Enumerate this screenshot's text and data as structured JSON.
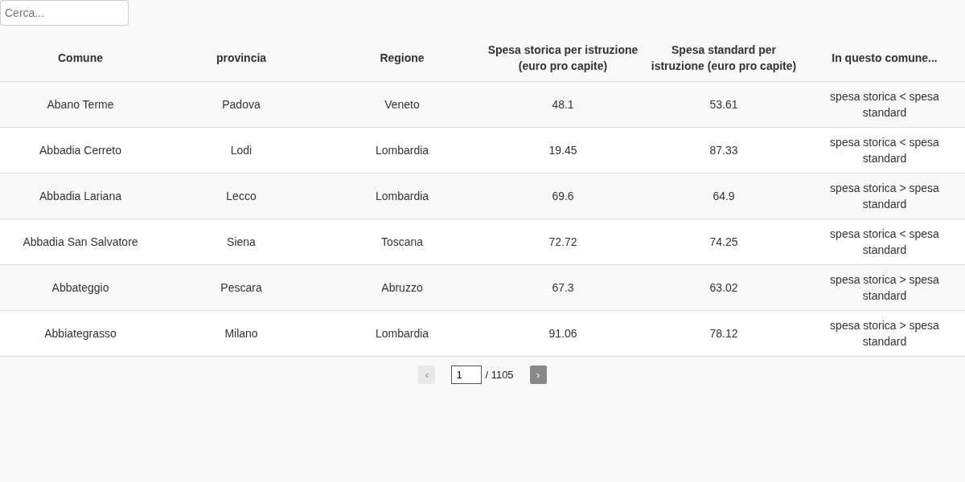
{
  "search": {
    "placeholder": "Cerca..."
  },
  "table": {
    "columns": [
      "Comune",
      "provincia",
      "Regione",
      "Spesa storica per istruzione (euro pro capite)",
      "Spesa standard per istruzione (euro pro capite)",
      "In questo comune..."
    ],
    "rows": [
      [
        "Abano Terme",
        "Padova",
        "Veneto",
        "48.1",
        "53.61",
        "spesa storica < spesa standard"
      ],
      [
        "Abbadia Cerreto",
        "Lodi",
        "Lombardia",
        "19.45",
        "87.33",
        "spesa storica < spesa standard"
      ],
      [
        "Abbadia Lariana",
        "Lecco",
        "Lombardia",
        "69.6",
        "64.9",
        "spesa storica > spesa standard"
      ],
      [
        "Abbadia San Salvatore",
        "Siena",
        "Toscana",
        "72.72",
        "74.25",
        "spesa storica < spesa standard"
      ],
      [
        "Abbateggio",
        "Pescara",
        "Abruzzo",
        "67.3",
        "63.02",
        "spesa storica > spesa standard"
      ],
      [
        "Abbiategrasso",
        "Milano",
        "Lombardia",
        "91.06",
        "78.12",
        "spesa storica > spesa standard"
      ]
    ]
  },
  "pagination": {
    "prev": {
      "label": "‹",
      "disabled": true
    },
    "page": "1",
    "total": "/ 1105",
    "next": {
      "label": "›",
      "disabled": false
    }
  }
}
